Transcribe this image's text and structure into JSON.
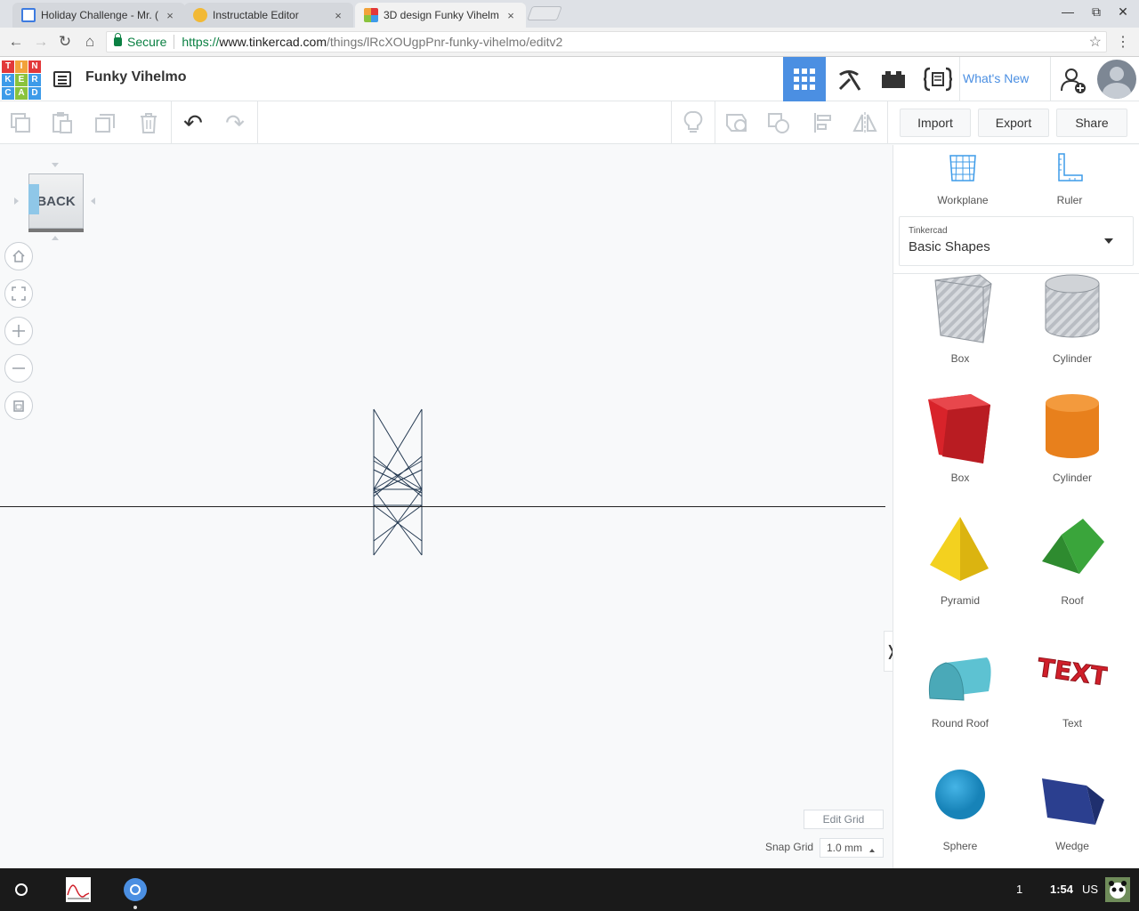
{
  "browser": {
    "tabs": [
      {
        "title": "Holiday Challenge - Mr. (",
        "active": false
      },
      {
        "title": "Instructable Editor",
        "active": false
      },
      {
        "title": "3D design Funky Vihelm",
        "active": true
      }
    ],
    "close_glyph": "×",
    "window_controls": {
      "minimize": "—",
      "maximize": "⧉",
      "close": "✕"
    },
    "nav": {
      "back": "←",
      "forward": "→",
      "reload": "↻",
      "home": "⌂"
    },
    "secure_label": "Secure",
    "url_scheme": "https://",
    "url_host": "www.tinkercad.com",
    "url_path": "/things/lRcXOUgpPnr-funky-vihelmo/editv2",
    "star": "☆",
    "menu": "⋮"
  },
  "header": {
    "logo_letters": [
      "T",
      "I",
      "N",
      "K",
      "E",
      "R",
      "C",
      "A",
      "D"
    ],
    "logo_colors": [
      "#e2383a",
      "#f2a23a",
      "#e2383a",
      "#3d9be9",
      "#8ac33d",
      "#3d9be9",
      "#3d9be9",
      "#8ac33d",
      "#3d9be9"
    ],
    "design_name": "Funky Vihelmo",
    "whats_new": "What's New",
    "accent": "#4b8fe2"
  },
  "edit_toolbar": {
    "import_label": "Import",
    "export_label": "Export",
    "share_label": "Share",
    "undo": "↶",
    "redo": "↷"
  },
  "workplane": {
    "viewcube_label": "BACK",
    "edit_grid_label": "Edit Grid",
    "snap_grid_label": "Snap Grid",
    "snap_grid_value": "1.0 mm",
    "collapse_glyph": "❭"
  },
  "panel": {
    "workplane_label": "Workplane",
    "ruler_label": "Ruler",
    "library_source": "Tinkercad",
    "library_name": "Basic Shapes",
    "shapes": [
      {
        "name": "Box",
        "kind": "box-hole"
      },
      {
        "name": "Cylinder",
        "kind": "cylinder-hole"
      },
      {
        "name": "Box",
        "kind": "box",
        "color": "#d8232a"
      },
      {
        "name": "Cylinder",
        "kind": "cylinder",
        "color": "#e8801c"
      },
      {
        "name": "Pyramid",
        "kind": "pyramid",
        "color": "#f3d11f"
      },
      {
        "name": "Roof",
        "kind": "roof",
        "color": "#3aa53b"
      },
      {
        "name": "Round Roof",
        "kind": "round-roof",
        "color": "#5dc2d2"
      },
      {
        "name": "Text",
        "kind": "text",
        "color": "#d01f2a",
        "glyph": "TEXT"
      },
      {
        "name": "Sphere",
        "kind": "sphere",
        "color": "#1c9ad6"
      },
      {
        "name": "Wedge",
        "kind": "wedge",
        "color": "#2b3f8f"
      }
    ]
  },
  "shelf": {
    "page_indicator": "1",
    "time": "1:54",
    "locale": "US"
  }
}
